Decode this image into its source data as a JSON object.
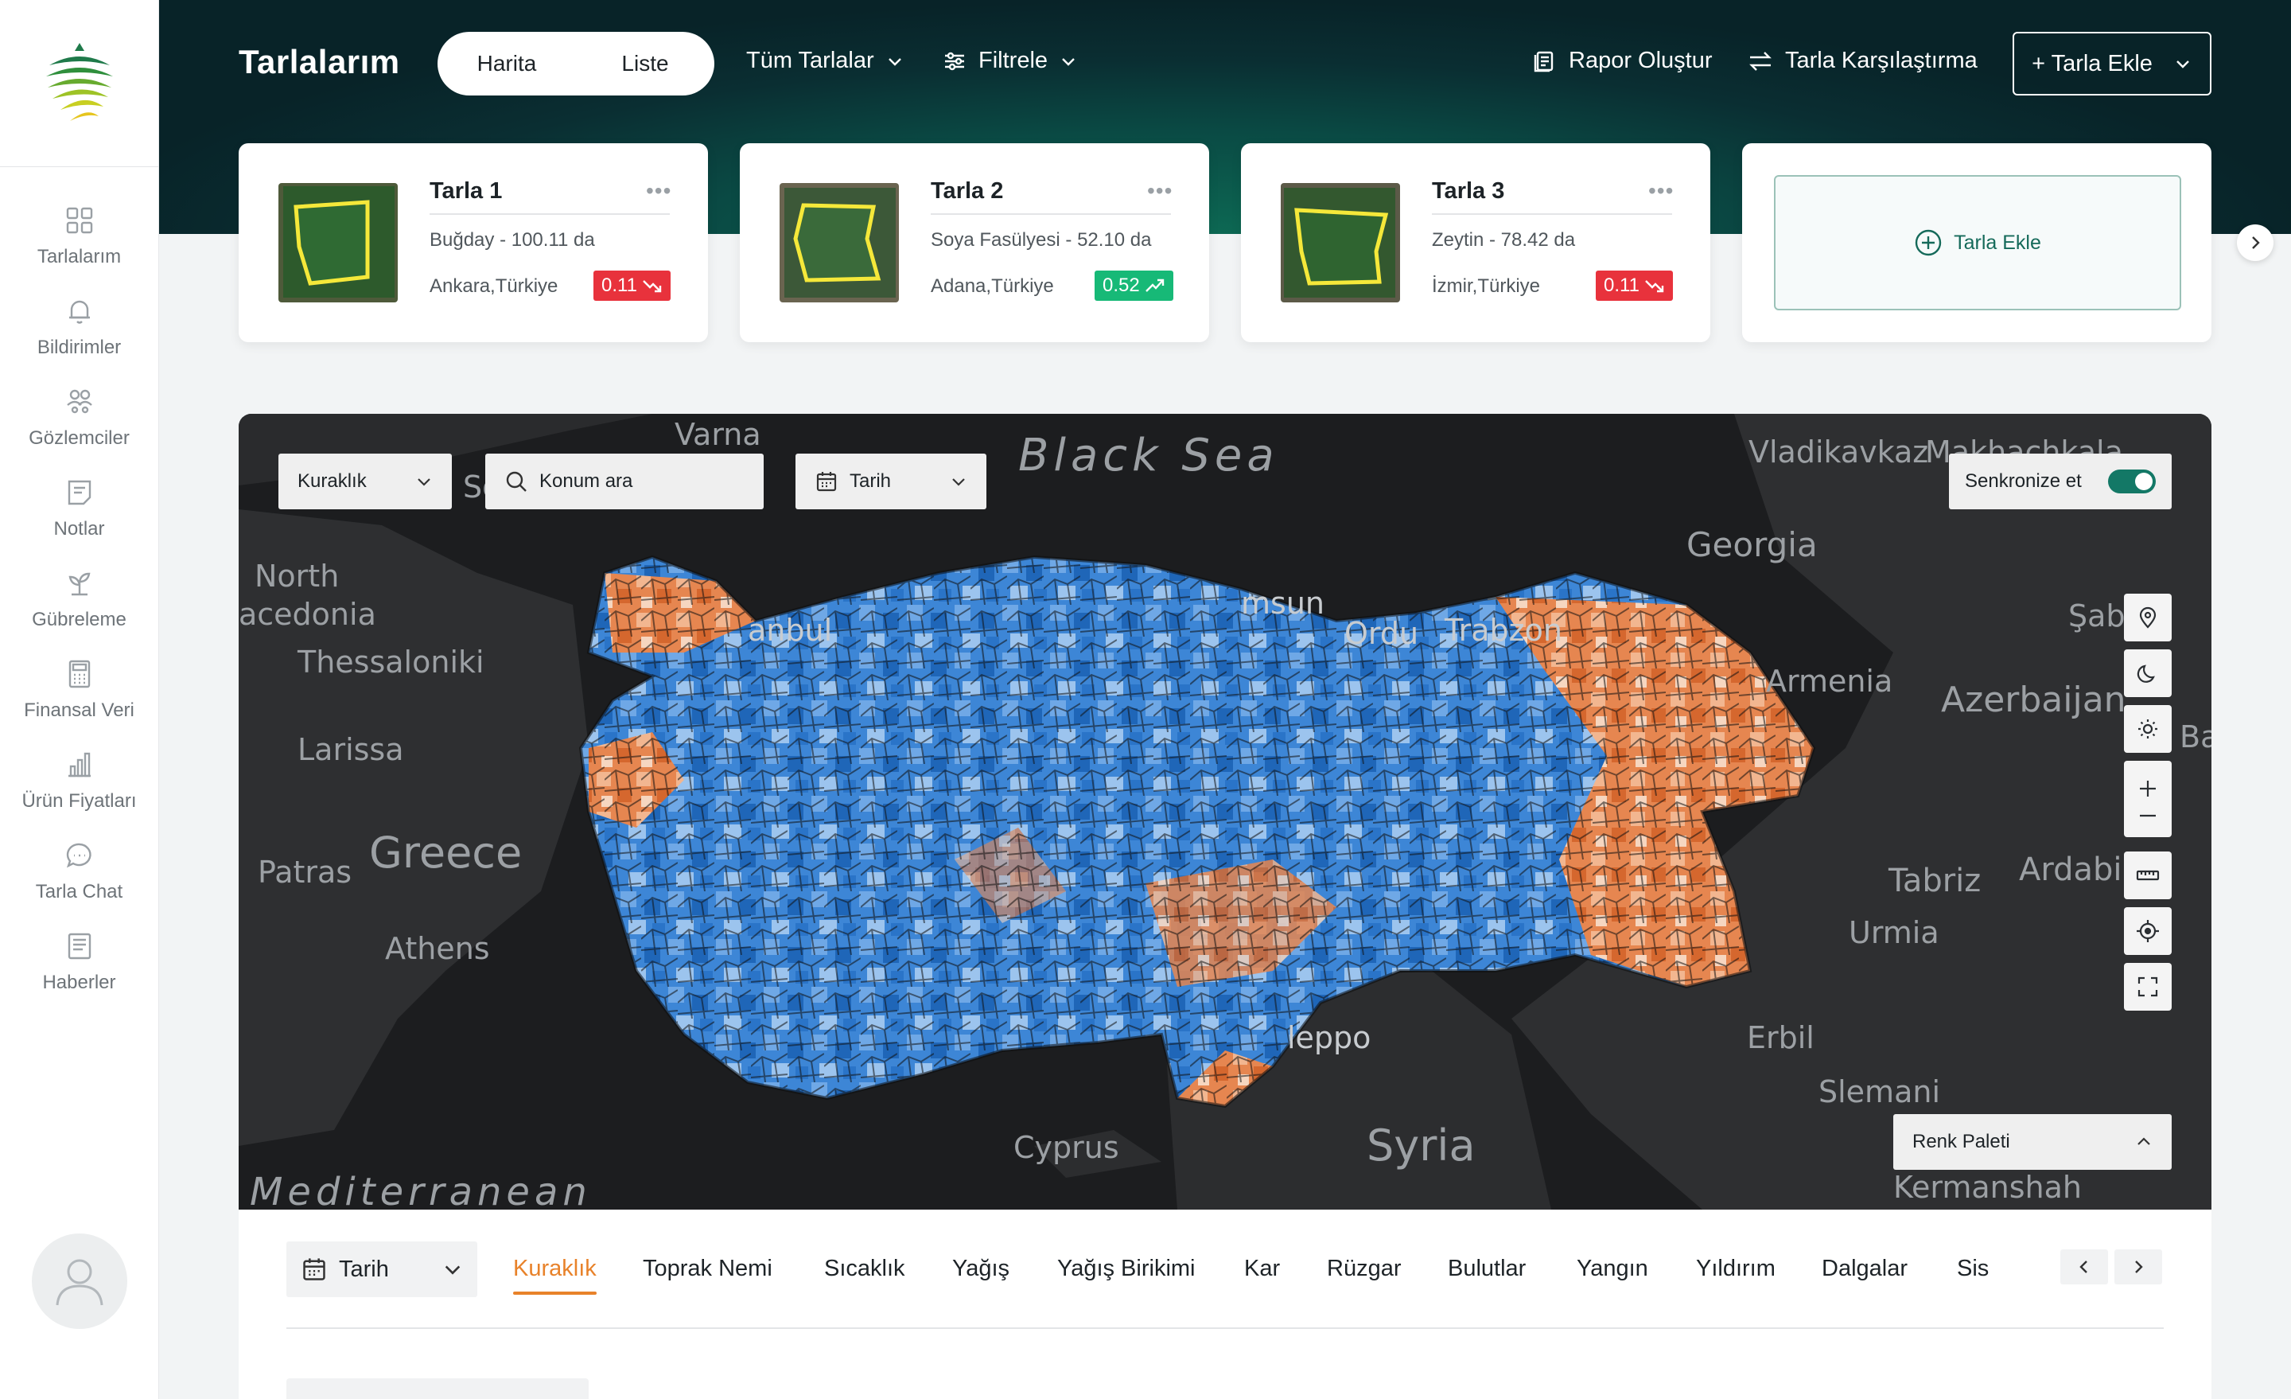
{
  "sidebar": {
    "items": [
      {
        "label": "Tarlalarım",
        "icon": "grid-icon"
      },
      {
        "label": "Bildirimler",
        "icon": "bell-icon"
      },
      {
        "label": "Gözlemciler",
        "icon": "users-icon"
      },
      {
        "label": "Notlar",
        "icon": "note-icon"
      },
      {
        "label": "Gübreleme",
        "icon": "plant-icon"
      },
      {
        "label": "Finansal Veri",
        "icon": "calculator-icon"
      },
      {
        "label": "Ürün Fiyatları",
        "icon": "bar-chart-icon"
      },
      {
        "label": "Tarla Chat",
        "icon": "chat-icon"
      },
      {
        "label": "Haberler",
        "icon": "news-icon"
      }
    ]
  },
  "header": {
    "title": "Tarlalarım",
    "view_toggle": [
      "Harita",
      "Liste"
    ],
    "all_fields": "Tüm Tarlalar",
    "filter": "Filtrele",
    "report": "Rapor Oluştur",
    "compare": "Tarla Karşılaştırma",
    "add_field": "+ Tarla Ekle"
  },
  "cards": [
    {
      "name": "Tarla 1",
      "more": "•••",
      "crop": "Buğday - 100.11 da",
      "location": "Ankara,Türkiye",
      "value": "0.11",
      "trend": "down",
      "color": "#e8323c"
    },
    {
      "name": "Tarla 2",
      "more": "•••",
      "crop": "Soya Fasülyesi - 52.10 da",
      "location": "Adana,Türkiye",
      "value": "0.52",
      "trend": "up",
      "color": "#17b977"
    },
    {
      "name": "Tarla 3",
      "more": "•••",
      "crop": "Zeytin - 78.42 da",
      "location": "İzmir,Türkiye",
      "value": "0.11",
      "trend": "down",
      "color": "#e8323c"
    }
  ],
  "add_card": {
    "label": "Tarla Ekle"
  },
  "map": {
    "layer_select": "Kuraklık",
    "search_placeholder": "Konum ara",
    "date_select": "Tarih",
    "sync_label": "Senkronize et",
    "palette": "Renk Paleti",
    "labels": [
      {
        "text": "Varna"
      },
      {
        "text": "Black Sea"
      },
      {
        "text": "Vladikavkaz"
      },
      {
        "text": "Makhachkala"
      },
      {
        "text": "North"
      },
      {
        "text": "acedonia"
      },
      {
        "text": "Thessaloniki"
      },
      {
        "text": "Larissa"
      },
      {
        "text": "Greece"
      },
      {
        "text": "Patras"
      },
      {
        "text": "Athens"
      },
      {
        "text": "Georgia"
      },
      {
        "text": "Şabr"
      },
      {
        "text": "Armenia"
      },
      {
        "text": "Azerbaijan"
      },
      {
        "text": "Ba"
      },
      {
        "text": "Tabriz"
      },
      {
        "text": "Ardabil"
      },
      {
        "text": "Urmia"
      },
      {
        "text": "Erbil"
      },
      {
        "text": "Slemani"
      },
      {
        "text": "Kermanshah"
      },
      {
        "text": "Syria"
      },
      {
        "text": "Cyprus"
      },
      {
        "text": "Mediterranean"
      },
      {
        "text": "Ordu"
      },
      {
        "text": "Trabzon"
      },
      {
        "text": "msun"
      },
      {
        "text": "anbul"
      },
      {
        "text": "leppo"
      },
      {
        "text": "Sofia"
      }
    ]
  },
  "tabs": {
    "date": "Tarih",
    "items": [
      "Kuraklık",
      "Toprak Nemi",
      "Sıcaklık",
      "Yağış",
      "Yağış Birikimi",
      "Kar",
      "Rüzgar",
      "Bulutlar",
      "Yangın",
      "Yıldırım",
      "Dalgalar",
      "Sis"
    ],
    "active": "Kuraklık"
  },
  "colors": {
    "accent": "#137866",
    "active_tab": "#e8822a",
    "drought_dry": "#e0733a",
    "drought_wet": "#2f7fd0"
  }
}
